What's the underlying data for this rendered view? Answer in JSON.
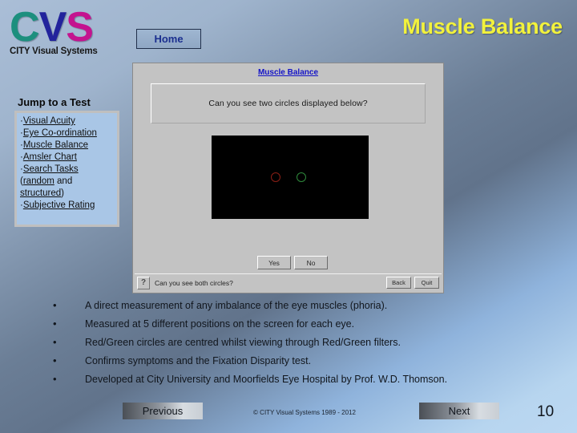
{
  "brand": {
    "logo_c": "C",
    "logo_v": "V",
    "logo_s": "S",
    "tagline": "CITY Visual Systems"
  },
  "header": {
    "home_label": "Home",
    "title": "Muscle Balance",
    "title_color": "#f2f23c"
  },
  "sidebar": {
    "heading": "Jump to a Test",
    "bullet": "·",
    "items": [
      {
        "label": "Visual Acuity"
      },
      {
        "label": "Eye Co-ordination"
      },
      {
        "label": "Muscle Balance"
      },
      {
        "label": "Amsler Chart"
      },
      {
        "label": "Search Tasks"
      }
    ],
    "search_tasks_detail": {
      "open_paren": "(",
      "random": "random",
      "and": " and ",
      "structured": "structured",
      "close_paren": ")"
    },
    "last_item": {
      "label": "Subjective Rating"
    }
  },
  "app": {
    "title": "Muscle Balance",
    "question": "Can you see two circles displayed below?",
    "stimulus": {
      "background": "#000000",
      "left_circle_color": "#8c1f16",
      "left_circle_name": "red",
      "right_circle_color": "#2f8a3c",
      "right_circle_name": "green"
    },
    "yes_label": "Yes",
    "no_label": "No",
    "status_icon": "?",
    "status_text": "Can you see both circles?",
    "back_label": "Back",
    "quit_label": "Quit"
  },
  "main": {
    "bullet_mark": "•",
    "bullets": [
      "A direct measurement of any imbalance of the eye muscles (phoria).",
      "Measured at 5 different positions on the screen for each eye.",
      "Red/Green circles are centred whilst viewing through Red/Green filters.",
      "Confirms symptoms and the Fixation Disparity test.",
      "Developed at City University and Moorfields Eye Hospital by Prof. W.D. Thomson."
    ]
  },
  "footer": {
    "previous_label": "Previous",
    "copyright": "© CITY Visual Systems 1989 - 2012",
    "next_label": "Next",
    "page_number": "10"
  }
}
